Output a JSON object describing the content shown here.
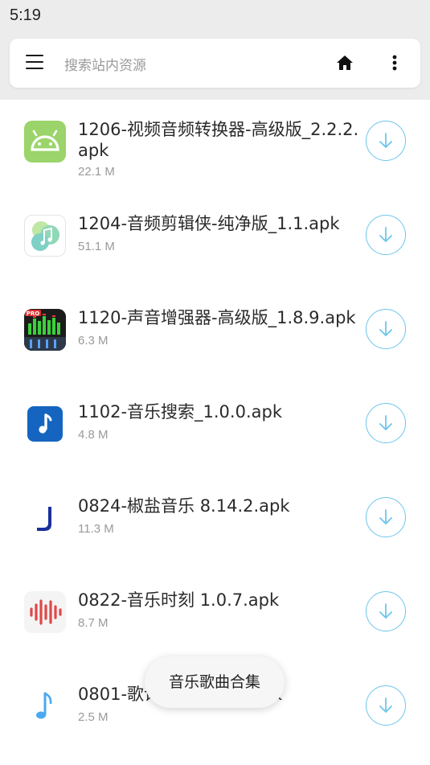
{
  "status_bar": {
    "time": "5:19"
  },
  "toolbar": {
    "search_placeholder": "搜索站内资源",
    "menu_icon": "hamburger-menu-icon",
    "home_icon": "home-icon",
    "more_icon": "more-vertical-icon"
  },
  "colors": {
    "accent": "#6cc6ec",
    "background": "#ececec"
  },
  "files": [
    {
      "name": "1206-视频音频转换器-高级版_2.2.2.apk",
      "size": "22.1 M",
      "icon": "android-icon"
    },
    {
      "name": "1204-音频剪辑侠-纯净版_1.1.apk",
      "size": "51.1 M",
      "icon": "music-note-green-icon"
    },
    {
      "name": "1120-声音增强器-高级版_1.8.9.apk",
      "size": "6.3 M",
      "icon": "equalizer-pro-icon"
    },
    {
      "name": "1102-音乐搜索_1.0.0.apk",
      "size": "4.8 M",
      "icon": "music-note-blue-icon"
    },
    {
      "name": "0824-椒盐音乐 8.14.2.apk",
      "size": "11.3 M",
      "icon": "jiaoyan-logo-icon"
    },
    {
      "name": "0822-音乐时刻 1.0.7.apk",
      "size": "8.7 M",
      "icon": "sound-wave-icon"
    },
    {
      "name": "0801-歌词适配_4.0.3.apk",
      "size": "2.5 M",
      "icon": "music-note-lightblue-icon"
    }
  ],
  "toast": {
    "text": "音乐歌曲合集"
  }
}
